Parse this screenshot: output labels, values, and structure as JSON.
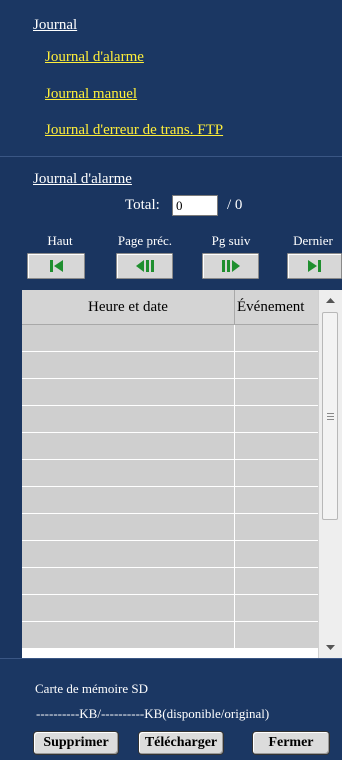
{
  "journal": {
    "heading": "Journal",
    "links": [
      {
        "label": "Journal d'alarme"
      },
      {
        "label": "Journal manuel"
      },
      {
        "label": "Journal d'erreur de trans. FTP"
      }
    ]
  },
  "log": {
    "title": "Journal d'alarme",
    "total_label": "Total:",
    "total_value": "0",
    "total_of": "/ 0"
  },
  "nav": {
    "first": {
      "label": "Haut",
      "icon": "first-page-icon"
    },
    "prev": {
      "label": "Page préc.",
      "icon": "previous-page-icon"
    },
    "next": {
      "label": "Pg suiv",
      "icon": "next-page-icon"
    },
    "last": {
      "label": "Dernier",
      "icon": "last-page-icon"
    },
    "icon_color": "#1f8f2f"
  },
  "table": {
    "columns": [
      "Heure et date",
      "Événement"
    ],
    "rows": [
      [
        "",
        ""
      ],
      [
        "",
        ""
      ],
      [
        "",
        ""
      ],
      [
        "",
        ""
      ],
      [
        "",
        ""
      ],
      [
        "",
        ""
      ],
      [
        "",
        ""
      ],
      [
        "",
        ""
      ],
      [
        "",
        ""
      ],
      [
        "",
        ""
      ],
      [
        "",
        ""
      ],
      [
        "",
        ""
      ]
    ]
  },
  "sd": {
    "title": "Carte de mémoire SD",
    "info": "----------KB/----------KB(disponible/original)"
  },
  "actions": {
    "delete": "Supprimer",
    "download": "Télécharger",
    "close": "Fermer"
  },
  "colors": {
    "panel_bg": "#1b3763",
    "link": "#ffef3a",
    "row_bg": "#cfcfcf"
  }
}
